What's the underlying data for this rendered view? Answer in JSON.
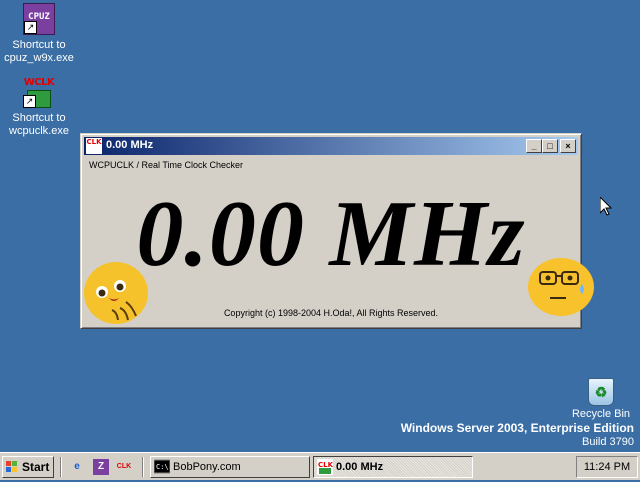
{
  "desktop": {
    "icons": [
      {
        "label_line1": "Shortcut to",
        "label_line2": "cpuz_w9x.exe",
        "glyph": "CPUZ"
      },
      {
        "label_line1": "Shortcut to",
        "label_line2": "wcpuclk.exe",
        "glyph": "WCLK"
      }
    ],
    "recycle_bin": "Recycle Bin",
    "os_name": "Windows Server 2003, Enterprise Edition",
    "os_build": "Build 3790"
  },
  "window": {
    "title": "0.00 MHz",
    "subtitle": "WCPUCLK / Real Time Clock Checker",
    "frequency": "0.00 MHz",
    "copyright": "Copyright (c) 1998-2004 H.Oda!,  All Rights Reserved.",
    "minimize_glyph": "_",
    "maximize_glyph": "□",
    "close_glyph": "×",
    "app_icon_text": "CLK"
  },
  "taskbar": {
    "start_label": "Start",
    "quick_launch": [
      {
        "icon": "internet-explorer-icon",
        "glyph": "e"
      },
      {
        "icon": "z-app-icon",
        "glyph": "Z"
      },
      {
        "icon": "wcpuclk-icon",
        "glyph": "CLK"
      }
    ],
    "tasks": [
      {
        "label": "BobPony.com",
        "icon": "command-prompt-icon",
        "active": false
      },
      {
        "label": "0.00 MHz",
        "icon": "wcpuclk-icon",
        "active": true
      }
    ],
    "clock": "11:24 PM"
  },
  "colors": {
    "desktop": "#3a6ea5",
    "titlebar_start": "#0a246a",
    "titlebar_end": "#a6caf0",
    "face": "#f7c62f"
  }
}
